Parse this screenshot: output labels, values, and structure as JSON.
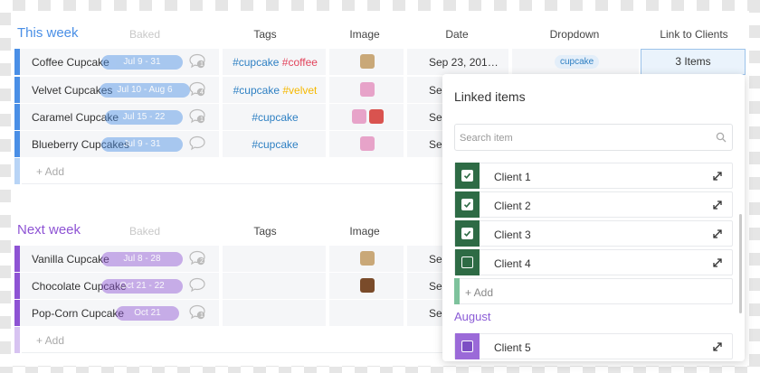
{
  "colors": {
    "group1": "#4a8fe6",
    "group2": "#8e53d4",
    "tag_blue": "#2f80c3",
    "tag_red": "#e2445c",
    "tag_yellow": "#f5b800",
    "client_checked": "#2e6b45",
    "august": "#9b6ad8"
  },
  "groups": [
    {
      "title": "This week",
      "columns": {
        "baked": "Baked",
        "tags": "Tags",
        "image": "Image",
        "date": "Date",
        "dropdown": "Dropdown",
        "link": "Link to Clients"
      },
      "rows": [
        {
          "name": "Coffee Cupcake",
          "baked": "Jul 9 - 31",
          "comments": "1",
          "tags": [
            "#cupcake",
            "#coffee"
          ],
          "date": "Sep 23, 201…",
          "dropdown": "cupcake",
          "link": "3 Items"
        },
        {
          "name": "Velvet Cupcakes",
          "baked": "Jul 10 - Aug 6",
          "comments": "4",
          "tags": [
            "#cupcake",
            "#velvet"
          ],
          "date": "Sep"
        },
        {
          "name": "Caramel Cupcake",
          "baked": "Jul 15 - 22",
          "comments": "1",
          "tags": [
            "#cupcake"
          ],
          "date": "Sep"
        },
        {
          "name": "Blueberry Cupcakes",
          "baked": "Jul 9 - 31",
          "comments": "",
          "tags": [
            "#cupcake"
          ],
          "date": "Sep"
        }
      ],
      "add_label": "+ Add"
    },
    {
      "title": "Next week",
      "columns": {
        "baked": "Baked",
        "tags": "Tags",
        "image": "Image"
      },
      "rows": [
        {
          "name": "Vanilla Cupcake",
          "baked": "Jul 8 - 28",
          "comments": "2",
          "date": "Sep"
        },
        {
          "name": "Chocolate Cupcake",
          "baked": "Oct 21 - 22",
          "comments": "",
          "date": "Sep"
        },
        {
          "name": "Pop-Corn Cupcake",
          "baked": "Oct 21",
          "comments": "1",
          "date": "Sep"
        }
      ],
      "add_label": "+ Add"
    }
  ],
  "popup": {
    "title": "Linked items",
    "search_placeholder": "Search item",
    "items": [
      {
        "label": "Client 1",
        "checked": true
      },
      {
        "label": "Client 2",
        "checked": true
      },
      {
        "label": "Client 3",
        "checked": true
      },
      {
        "label": "Client 4",
        "checked": false
      }
    ],
    "add_label": "+ Add",
    "group2_label": "August",
    "group2_items": [
      {
        "label": "Client 5",
        "checked": false
      }
    ]
  }
}
